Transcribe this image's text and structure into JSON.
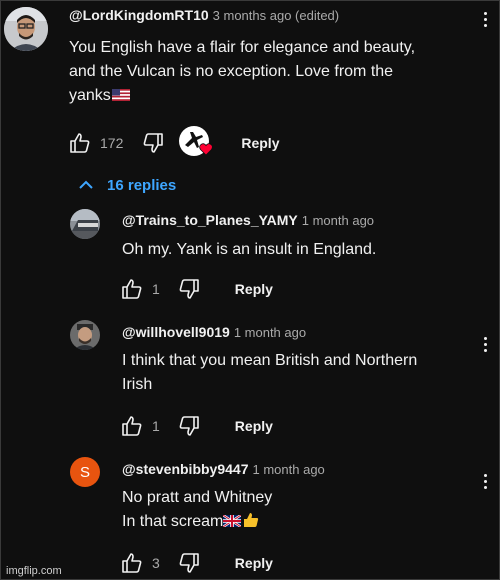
{
  "thread": {
    "top_comment": {
      "handle": "@LordKingdomRT10",
      "time": "3 months ago (edited)",
      "lines": [
        "You English have a flair for elegance and beauty,",
        "and the Vulcan is no exception.  Love from the",
        "yanks"
      ],
      "flag": "us-flag-emoji",
      "likes": "172",
      "reply_label": "Reply"
    },
    "replies_toggle": "16 replies",
    "replies": [
      {
        "handle": "@Trains_to_Planes_YAMY",
        "time": "1 month ago",
        "lines": [
          "Oh my. Yank is an insult in England."
        ],
        "likes": "1",
        "reply_label": "Reply"
      },
      {
        "handle": "@willhovell9019",
        "time": "1 month ago",
        "lines": [
          "I think that you mean British and Northern",
          "Irish"
        ],
        "likes": "1",
        "reply_label": "Reply"
      },
      {
        "handle": "@stevenbibby9447",
        "time": "1 month ago",
        "avatar_letter": "S",
        "lines": [
          "No pratt and Whitney",
          "In that scream"
        ],
        "emoji": [
          "uk-flag-emoji",
          "thumbs-up-emoji"
        ],
        "likes": "3",
        "reply_label": "Reply"
      }
    ]
  },
  "watermark": "imgflip.com",
  "colors": {
    "background": "#0f0f0f",
    "link": "#3ea6ff",
    "avatar_orange": "#e8540f",
    "heart": "#ff0033"
  }
}
